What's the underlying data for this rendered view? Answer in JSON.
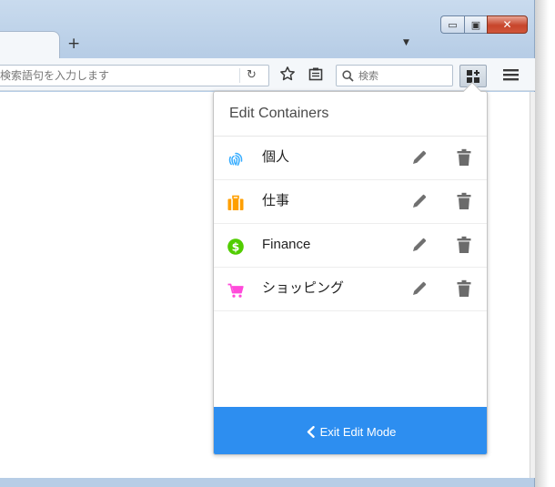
{
  "window": {
    "minimize_glyph": "▭",
    "maximize_glyph": "▣",
    "close_glyph": "✕",
    "new_tab_glyph": "+",
    "tab_list_glyph": "▼"
  },
  "toolbar": {
    "url_placeholder": "検索語句を入力します",
    "search_placeholder": "検索",
    "reload_glyph": "↻"
  },
  "panel": {
    "title": "Edit Containers",
    "exit_label": "Exit Edit Mode",
    "containers": [
      {
        "name": "個人",
        "icon": "fingerprint-icon",
        "color": "#37adff"
      },
      {
        "name": "仕事",
        "icon": "briefcase-icon",
        "color": "#ff9f00"
      },
      {
        "name": "Finance",
        "icon": "dollar-icon",
        "color": "#51cd00"
      },
      {
        "name": "ショッピング",
        "icon": "cart-icon",
        "color": "#ff4bda"
      }
    ]
  },
  "colors": {
    "accent": "#2d8ef0",
    "icon_gray": "#6b6b6b"
  }
}
